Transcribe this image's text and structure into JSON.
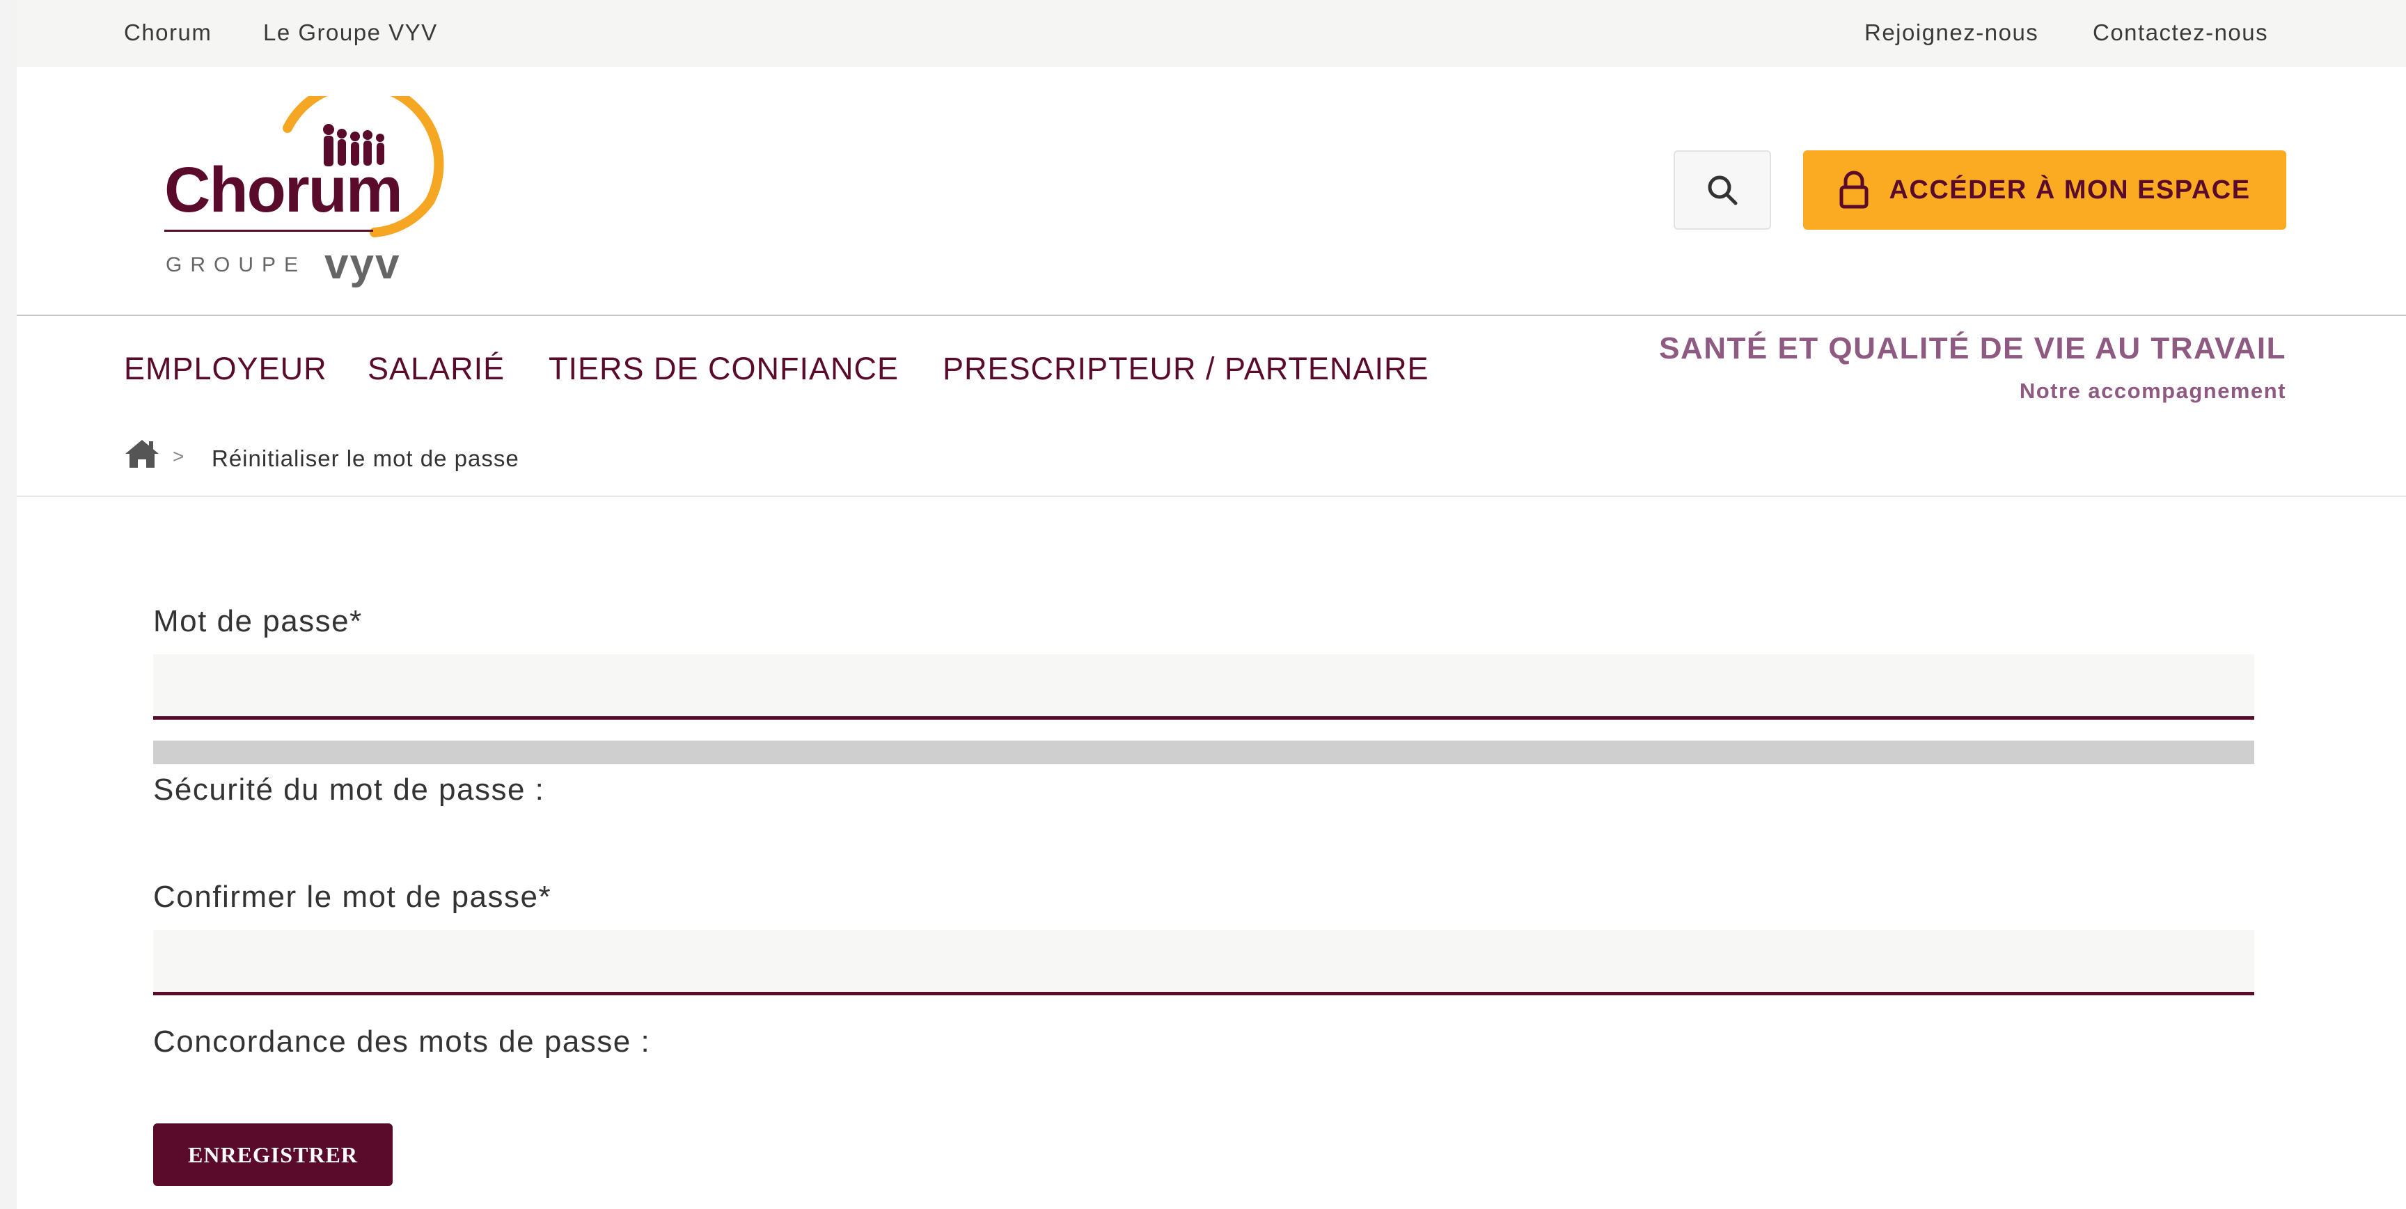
{
  "topbar": {
    "left_links": [
      "Chorum",
      "Le Groupe VYV"
    ],
    "right_links": [
      "Rejoignez-nous",
      "Contactez-nous"
    ]
  },
  "logo": {
    "name": "Chorum",
    "group_prefix": "GROUPE",
    "group_name": "vyv"
  },
  "header": {
    "search_icon": "search-icon",
    "access_button_label": "ACCÉDER À MON ESPACE",
    "access_icon": "lock-icon"
  },
  "nav": {
    "items": [
      "EMPLOYEUR",
      "SALARIÉ",
      "TIERS DE CONFIANCE",
      "PRESCRIPTEUR / PARTENAIRE"
    ],
    "sqvt_title": "SANTÉ ET QUALITÉ DE VIE AU TRAVAIL",
    "sqvt_subtitle": "Notre accompagnement"
  },
  "breadcrumb": {
    "home_icon": "home-icon",
    "separator": ">",
    "current": "Réinitialiser le mot de passe"
  },
  "form": {
    "password_label": "Mot de passe*",
    "password_value": "",
    "strength_label": "Sécurité du mot de passe :",
    "strength_level": 0,
    "confirm_label": "Confirmer le mot de passe*",
    "confirm_value": "",
    "match_label": "Concordance des mots de passe :",
    "save_label": "ENREGISTRER"
  },
  "colors": {
    "brand": "#5a0a2a",
    "accent": "#fbab21",
    "mauve": "#8e5a82",
    "logo_arc": "#f5a623"
  }
}
